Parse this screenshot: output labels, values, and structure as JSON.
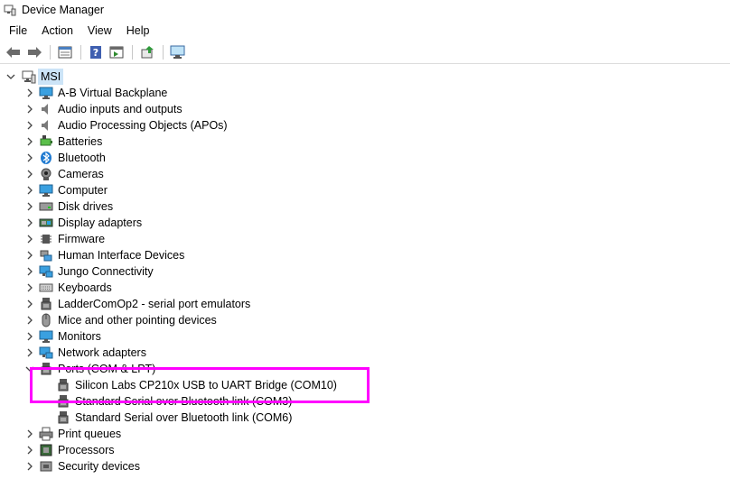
{
  "window": {
    "title": "Device Manager"
  },
  "menu": [
    {
      "label": "File"
    },
    {
      "label": "Action"
    },
    {
      "label": "View"
    },
    {
      "label": "Help"
    }
  ],
  "toolbar": {
    "buttons": [
      {
        "icon": "back-arrow-icon"
      },
      {
        "icon": "forward-arrow-icon"
      },
      {
        "icon": "properties-icon"
      },
      {
        "icon": "help-icon"
      },
      {
        "icon": "action-pane-icon"
      },
      {
        "icon": "update-driver-icon"
      },
      {
        "icon": "scan-hardware-icon"
      }
    ]
  },
  "tree": {
    "root": {
      "label": "MSI"
    },
    "categories": [
      {
        "label": "A-B Virtual Backplane",
        "icon": "monitor-network-icon"
      },
      {
        "label": "Audio inputs and outputs",
        "icon": "speaker-icon"
      },
      {
        "label": "Audio Processing Objects (APOs)",
        "icon": "speaker-icon"
      },
      {
        "label": "Batteries",
        "icon": "battery-icon"
      },
      {
        "label": "Bluetooth",
        "icon": "bluetooth-icon"
      },
      {
        "label": "Cameras",
        "icon": "camera-icon"
      },
      {
        "label": "Computer",
        "icon": "computer-icon"
      },
      {
        "label": "Disk drives",
        "icon": "disk-drive-icon"
      },
      {
        "label": "Display adapters",
        "icon": "display-adapter-icon"
      },
      {
        "label": "Firmware",
        "icon": "chip-icon"
      },
      {
        "label": "Human Interface Devices",
        "icon": "hid-icon"
      },
      {
        "label": "Jungo Connectivity",
        "icon": "network-icon"
      },
      {
        "label": "Keyboards",
        "icon": "keyboard-icon"
      },
      {
        "label": "LadderComOp2 - serial port emulators",
        "icon": "port-icon"
      },
      {
        "label": "Mice and other pointing devices",
        "icon": "mouse-icon"
      },
      {
        "label": "Monitors",
        "icon": "monitor-icon"
      },
      {
        "label": "Network adapters",
        "icon": "network-icon"
      },
      {
        "label": "Ports (COM & LPT)",
        "icon": "port-icon",
        "expanded": true
      },
      {
        "label": "Print queues",
        "icon": "printer-icon"
      },
      {
        "label": "Processors",
        "icon": "processor-icon"
      },
      {
        "label": "Security devices",
        "icon": "security-icon"
      }
    ],
    "ports_children": [
      {
        "label": "Silicon Labs CP210x USB to UART Bridge (COM10)",
        "icon": "port-icon"
      },
      {
        "label": "Standard Serial over Bluetooth link (COM3)",
        "icon": "port-icon"
      },
      {
        "label": "Standard Serial over Bluetooth link (COM6)",
        "icon": "port-icon"
      }
    ]
  },
  "colors": {
    "highlight_box": "#ff00ff",
    "selection": "#cce4f7"
  }
}
